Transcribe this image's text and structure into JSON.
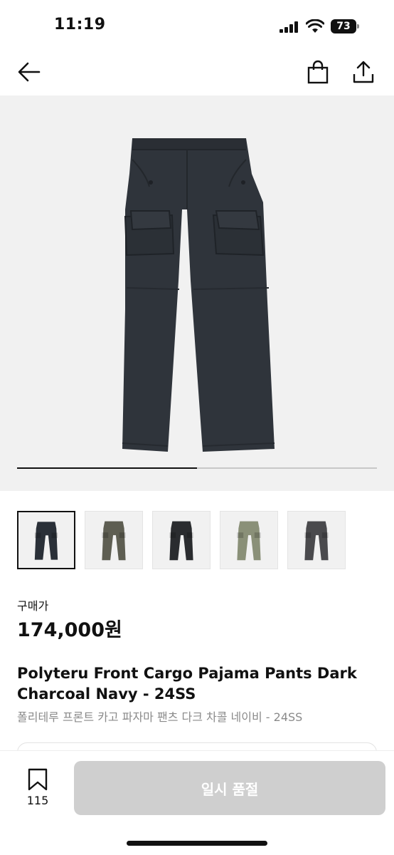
{
  "status_bar": {
    "time": "11:19",
    "battery_level": "73"
  },
  "nav": {
    "back_icon": "arrow-left-icon",
    "bag_icon": "shopping-bag-icon",
    "share_icon": "share-icon"
  },
  "gallery": {
    "progress": 0.5,
    "image_subject": "dark charcoal navy cargo pants"
  },
  "thumbnails": [
    {
      "color": "#2a3038",
      "selected": true
    },
    {
      "color": "#5e5e52",
      "selected": false
    },
    {
      "color": "#2a2c2f",
      "selected": false
    },
    {
      "color": "#8a9078",
      "selected": false
    },
    {
      "color": "#4a4a4d",
      "selected": false
    }
  ],
  "product": {
    "price_label": "구매가",
    "price": "174,000원",
    "title_en": "Polyteru Front Cargo Pajama Pants Dark Charcoal Navy - 24SS",
    "title_ko": "폴리테루 프론트 카고 파자마 팬츠 다크 차콜 네이비 - 24SS"
  },
  "bottom_bar": {
    "bookmark_count": "115",
    "soldout_label": "일시 품절"
  },
  "colors": {
    "soldout_button_bg": "#cfcfcf",
    "gallery_bg": "#f1f1f1",
    "text_primary": "#111111",
    "text_secondary": "#8a8a8a"
  }
}
